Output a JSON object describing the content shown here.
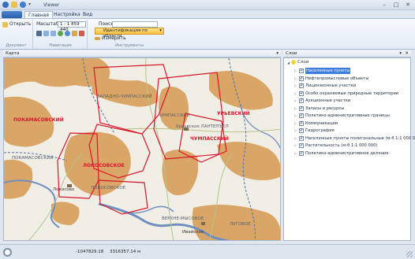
{
  "window": {
    "title": "Viewer",
    "minimize": "–",
    "maximize": "□",
    "close": "✕"
  },
  "ribbon_tabs": [
    "Главная",
    "Настройка",
    "Вид"
  ],
  "ribbon": {
    "open_label": "Открыть",
    "scale_label": "Масштаб:",
    "scale_value": "1 : 1 859 440",
    "search_label": "Поиск:",
    "search_value": "",
    "identify_label": "Идентификация по области",
    "measure_label": "Измерить",
    "groups": [
      "Документ",
      "Навигация",
      "Инструменты"
    ]
  },
  "map_panel": {
    "title": "Карта",
    "pin": "▾"
  },
  "map_labels": [
    "ЗАПАДНО-ЧУМПАССКИЙ",
    "ПОКАМАСОВСКИЙ",
    "ЧУМПАССКИЙ",
    "УРЬЕВСКИЙ",
    "Урьевское   ЛАНТЕПЪЕЛ",
    "ЧУМПАССКИЙ",
    "ПОКАМАСОВСКИЙ",
    "ЛОКОСОВСКОЕ",
    "ЛОКОСОВСКОЕ",
    "Локосово",
    "ВЕРХНЕ-МЫСОВОЕ",
    "Ивайское",
    "ЛУГОВОЕ"
  ],
  "layers_panel": {
    "title": "Слои",
    "root_label": "Слои",
    "items": [
      {
        "label": "Населенные пункты",
        "checked": true,
        "selected": true
      },
      {
        "label": "Нефтепромысловые объекты",
        "checked": true,
        "selected": false
      },
      {
        "label": "Лицензионные участки",
        "checked": true,
        "selected": false
      },
      {
        "label": "Особо охраняемые природные территории",
        "checked": true,
        "selected": false
      },
      {
        "label": "Аукционные участки",
        "checked": true,
        "selected": false
      },
      {
        "label": "Запасы и ресурсы",
        "checked": true,
        "selected": false
      },
      {
        "label": "Политико-административные границы",
        "checked": true,
        "selected": false
      },
      {
        "label": "Коммуникации",
        "checked": true,
        "selected": false
      },
      {
        "label": "Гидрография",
        "checked": true,
        "selected": false
      },
      {
        "label": "Населенные пункты полигональные (м-б 1:1 000 000)",
        "checked": true,
        "selected": false
      },
      {
        "label": "Растительность (м-б 1:1 000 000)",
        "checked": true,
        "selected": false
      },
      {
        "label": "Политико-административное деление",
        "checked": true,
        "selected": false
      }
    ]
  },
  "status": {
    "x": "-1047829.18",
    "y": "3316357.14",
    "unit": "м"
  },
  "colors": {
    "accent": "#3d7de0",
    "terrain": "#d9a667",
    "boundary": "#d8172c",
    "water": "#6f8fc0",
    "road": "#b6c48a"
  }
}
